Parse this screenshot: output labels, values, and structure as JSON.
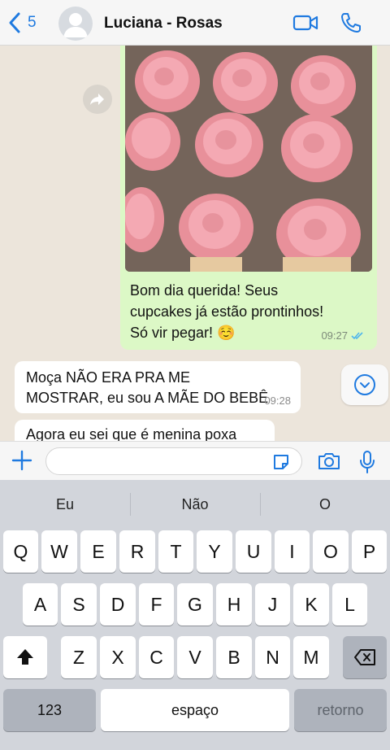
{
  "header": {
    "back_count": "5",
    "title": "Luciana - Rosas"
  },
  "messages": {
    "outgoing_text": "Bom dia querida! Seus cupcakes já estão prontinhos! Só vir pegar! ☺️",
    "outgoing_time": "09:27",
    "incoming_text": "Moça NÃO ERA PRA ME MOSTRAR, eu sou A MÃE DO BEBÊ",
    "incoming_time": "09:28",
    "incoming_partial": "Agora eu sei que é menina poxa"
  },
  "input": {
    "value": "",
    "placeholder": ""
  },
  "keyboard": {
    "suggestions": [
      "Eu",
      "Não",
      "O"
    ],
    "row1": [
      "Q",
      "W",
      "E",
      "R",
      "T",
      "Y",
      "U",
      "I",
      "O",
      "P"
    ],
    "row2": [
      "A",
      "S",
      "D",
      "F",
      "G",
      "H",
      "J",
      "K",
      "L"
    ],
    "row3": [
      "Z",
      "X",
      "C",
      "V",
      "B",
      "N",
      "M"
    ],
    "numbers_label": "123",
    "space_label": "espaço",
    "return_label": "retorno"
  },
  "colors": {
    "accent": "#1f7ae0",
    "outgoing_bubble": "#dcf8c6",
    "incoming_bubble": "#ffffff",
    "chat_bg": "#ece5db",
    "keyboard_bg": "#d2d5db"
  }
}
